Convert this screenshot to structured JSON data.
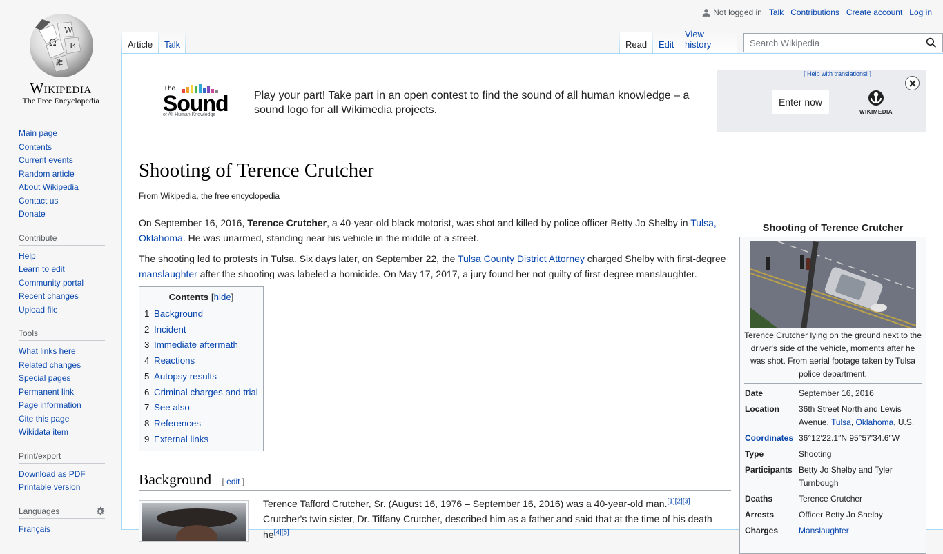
{
  "logo": {
    "wordmark": "Wikipedia",
    "tagline": "The Free Encyclopedia"
  },
  "personal": {
    "not_logged_in": "Not logged in",
    "talk": "Talk",
    "contributions": "Contributions",
    "create_account": "Create account",
    "login": "Log in"
  },
  "tabs": {
    "article": "Article",
    "talk": "Talk",
    "read": "Read",
    "edit": "Edit",
    "history": "View history"
  },
  "search": {
    "placeholder": "Search Wikipedia"
  },
  "sidebar": {
    "navigation": [
      "Main page",
      "Contents",
      "Current events",
      "Random article",
      "About Wikipedia",
      "Contact us",
      "Donate"
    ],
    "contribute": {
      "heading": "Contribute",
      "items": [
        "Help",
        "Learn to edit",
        "Community portal",
        "Recent changes",
        "Upload file"
      ]
    },
    "tools": {
      "heading": "Tools",
      "items": [
        "What links here",
        "Related changes",
        "Special pages",
        "Permanent link",
        "Page information",
        "Cite this page",
        "Wikidata item"
      ]
    },
    "print": {
      "heading": "Print/export",
      "items": [
        "Download as PDF",
        "Printable version"
      ]
    },
    "languages": {
      "heading": "Languages",
      "items": [
        "Français"
      ]
    }
  },
  "banner": {
    "logo_the": "The",
    "logo_word": "Sound",
    "logo_sub": "of All Human Knowledge",
    "message": "Play your part! Take part in an open contest to find the sound of all human knowledge – a sound logo for all Wikimedia projects.",
    "help": "[ Help with translations! ]",
    "enter": "Enter now",
    "wm": "WIKIMEDIA"
  },
  "article": {
    "title": "Shooting of Terence Crutcher",
    "site_sub": "From Wikipedia, the free encyclopedia",
    "p1": {
      "a": "On September 16, 2016, ",
      "b": "Terence Crutcher",
      "c": ", a 40-year-old black motorist, was shot and killed by police officer Betty Jo Shelby in ",
      "link": "Tulsa, Oklahoma",
      "d": ". He was unarmed, standing near his vehicle in the middle of a street."
    },
    "p2": {
      "a": "The shooting led to protests in Tulsa. Six days later, on September 22, the ",
      "link1": "Tulsa County District Attorney",
      "b": " charged Shelby with first-degree ",
      "link2": "manslaughter",
      "c": " after the shooting was labeled a homicide. On May 17, 2017, a jury found her not guilty of first-degree manslaughter."
    },
    "section_bg": "Background",
    "edit": "edit",
    "bg_text": {
      "a": "Terence Tafford Crutcher, Sr. (August 16, 1976 – September 16, 2016) was a 40-year-old man.",
      "refs1": "[1][2][3]",
      "b": "Crutcher's twin sister, Dr. Tiffany Crutcher, described him as a father and said that at the time of his death he",
      "refs2": "[4][5]"
    }
  },
  "toc": {
    "title": "Contents",
    "hide": "hide",
    "items": [
      {
        "num": "1",
        "label": "Background"
      },
      {
        "num": "2",
        "label": "Incident"
      },
      {
        "num": "3",
        "label": "Immediate aftermath"
      },
      {
        "num": "4",
        "label": "Reactions"
      },
      {
        "num": "5",
        "label": "Autopsy results"
      },
      {
        "num": "6",
        "label": "Criminal charges and trial"
      },
      {
        "num": "7",
        "label": "See also"
      },
      {
        "num": "8",
        "label": "References"
      },
      {
        "num": "9",
        "label": "External links"
      }
    ]
  },
  "infobox": {
    "caption": "Shooting of Terence Crutcher",
    "image_caption": "Terence Crutcher lying on the ground next to the driver's side of the vehicle, moments after he was shot. From aerial footage taken by Tulsa police department.",
    "date_label": "Date",
    "date": "September 16, 2016",
    "location_label": "Location",
    "location_a": "36th Street North and Lewis Avenue, ",
    "location_link1": "Tulsa",
    "location_comma": ", ",
    "location_link2": "Oklahoma",
    "location_b": ", U.S.",
    "coords_label": "Coordinates",
    "coords": "36°12′22.1″N 95°57′34.6″W",
    "type_label": "Type",
    "type": "Shooting",
    "participants_label": "Participants",
    "participants": "Betty Jo Shelby and Tyler Turnbough",
    "deaths_label": "Deaths",
    "deaths": "Terence Crutcher",
    "arrests_label": "Arrests",
    "arrests": "Officer Betty Jo Shelby",
    "charges_label": "Charges",
    "charges": "Manslaughter"
  },
  "colors": {
    "link": "#0645ad",
    "border": "#a7d7f9",
    "panel": "#f8f9fa"
  }
}
